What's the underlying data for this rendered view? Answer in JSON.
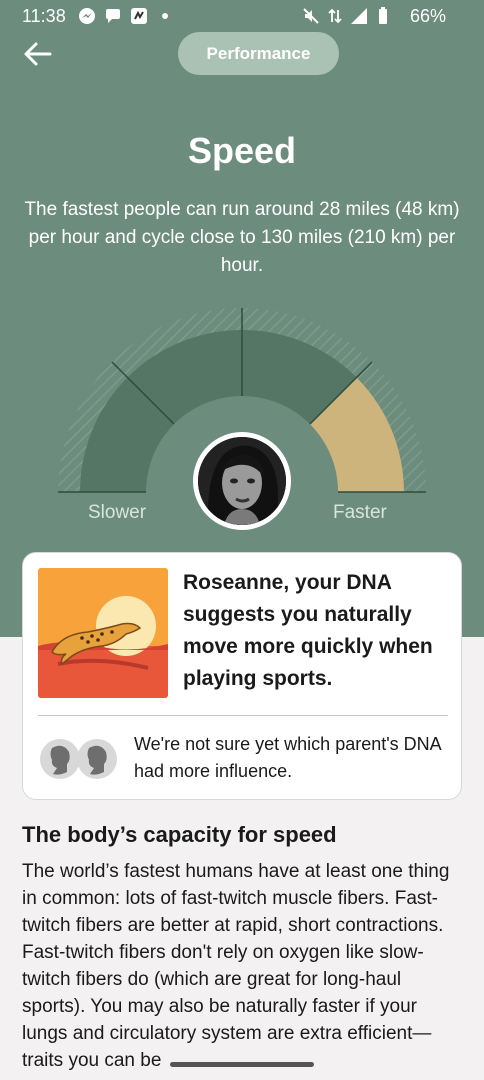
{
  "status_bar": {
    "time": "11:38",
    "battery": "66%",
    "icons_left": [
      "messenger-icon",
      "chat-icon",
      "app-icon",
      "dot-icon"
    ],
    "icons_right": [
      "mute-icon",
      "data-icon",
      "signal-icon",
      "battery-icon"
    ]
  },
  "header": {
    "back_icon": "arrow-left-icon",
    "category": "Performance"
  },
  "hero": {
    "title": "Speed",
    "description": "The fastest people can run around 28 miles (48 km) per hour and cycle close to 130 miles (210 km) per hour."
  },
  "gauge": {
    "min_label": "Slower",
    "max_label": "Faster",
    "segments": 4,
    "highlighted_segment": 4,
    "colors": {
      "track": "#557565",
      "highlight": "#cdb47c",
      "background": "#6c8c7d"
    }
  },
  "result_card": {
    "headline": "Roseanne, your DNA suggests you naturally move more quickly when playing sports.",
    "parent_note": "We're not sure yet which parent's DNA had more influence.",
    "image_icon": "cheetah-illustration",
    "parent_icon": "parents-icon"
  },
  "article": {
    "heading": "The body’s capacity for speed",
    "body": "The world’s fastest humans have at least one thing in common: lots of fast-twitch muscle fibers. Fast-twitch fibers are better at rapid, short contractions. Fast-twitch fibers don't rely on oxygen like slow-twitch fibers do (which are great for long-haul sports). You may also be naturally faster if your lungs and circulatory system are extra efficient—traits you can be"
  }
}
